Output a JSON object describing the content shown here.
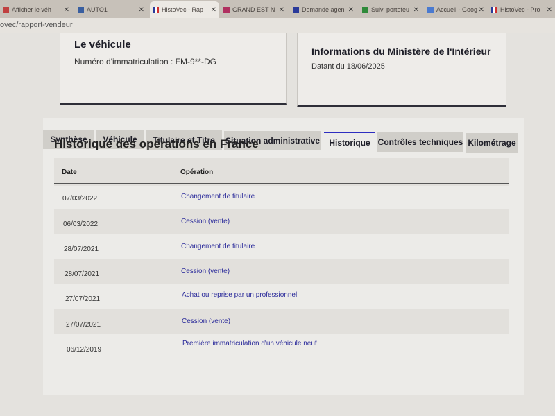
{
  "browser": {
    "tabs": [
      {
        "title": "Afficher le véh"
      },
      {
        "title": "AUTO1"
      },
      {
        "title": "HistoVec - Rap"
      },
      {
        "title": "GRAND EST N"
      },
      {
        "title": "Demande agen"
      },
      {
        "title": "Suivi portefeu"
      },
      {
        "title": "Accueil - Goog"
      },
      {
        "title": "HistoVec - Pro"
      }
    ],
    "url": "ovec/rapport-vendeur"
  },
  "vehicle_card": {
    "title": "Le véhicule",
    "registration": "Numéro d'immatriculation : FM-9**-DG"
  },
  "ministry_card": {
    "title": "Informations du Ministère de l'Intérieur",
    "date": "Datant du 18/06/2025"
  },
  "tabs": [
    {
      "label": "Synthèse"
    },
    {
      "label": "Véhicule"
    },
    {
      "label": "Titulaire et Titre"
    },
    {
      "label": "Situation administrative"
    },
    {
      "label": "Historique"
    },
    {
      "label": "Contrôles techniques"
    },
    {
      "label": "Kilométrage"
    }
  ],
  "active_tab": "Historique",
  "history": {
    "title": "Historique des opérations en France",
    "columns": {
      "date": "Date",
      "operation": "Opération"
    },
    "rows": [
      {
        "date": "07/03/2022",
        "operation": "Changement de titulaire"
      },
      {
        "date": "06/03/2022",
        "operation": "Cession (vente)"
      },
      {
        "date": "28/07/2021",
        "operation": "Changement de titulaire"
      },
      {
        "date": "28/07/2021",
        "operation": "Cession (vente)"
      },
      {
        "date": "27/07/2021",
        "operation": "Achat ou reprise par un professionnel"
      },
      {
        "date": "27/07/2021",
        "operation": "Cession (vente)"
      },
      {
        "date": "06/12/2019",
        "operation": "Première immatriculation d'un véhicule neuf"
      }
    ]
  },
  "colors": {
    "accent": "#2d2dc0",
    "link": "#2a2a9a"
  },
  "icons": {
    "tab_close": "close-icon",
    "favicon": "favicon-icon"
  }
}
